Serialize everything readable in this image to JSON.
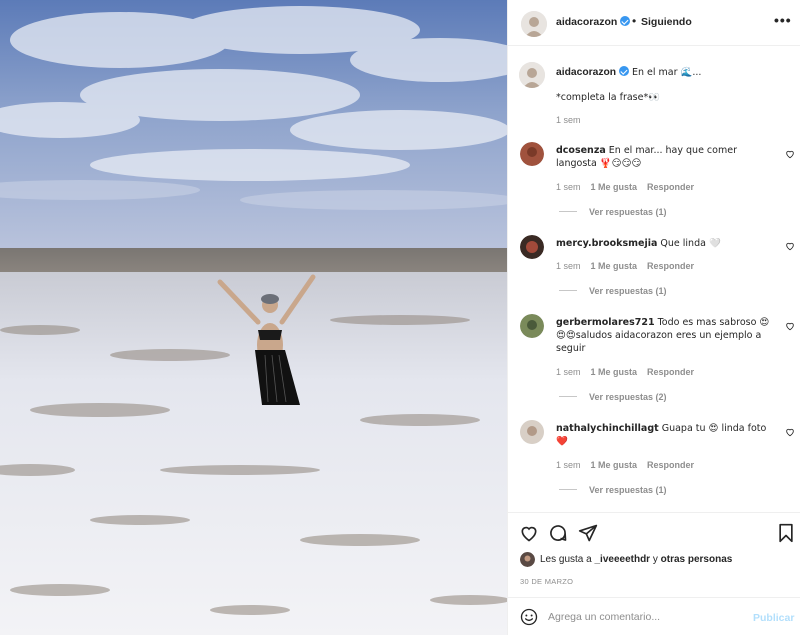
{
  "header": {
    "username": "aidacorazon",
    "separator": "•",
    "follow_label": "Siguiendo",
    "more_label": "•••"
  },
  "caption": {
    "username": "aidacorazon",
    "text_line1": "En el mar 🌊...",
    "text_line2": "*completa la frase*👀",
    "time": "1 sem"
  },
  "comments": [
    {
      "username": "dcosenza",
      "text": "En el mar... hay que comer langosta 🦞😏😏😏",
      "time": "1 sem",
      "likes": "1 Me gusta",
      "reply": "Responder",
      "view_replies": "Ver respuestas (1)"
    },
    {
      "username": "mercy.brooksmejia",
      "text": "Que linda 🤍",
      "time": "1 sem",
      "likes": "1 Me gusta",
      "reply": "Responder",
      "view_replies": "Ver respuestas (1)"
    },
    {
      "username": "gerbermolares721",
      "text": "Todo es mas sabroso 😍😍😍saludos aidacorazon eres un ejemplo a seguir",
      "time": "1 sem",
      "likes": "1 Me gusta",
      "reply": "Responder",
      "view_replies": "Ver respuestas (2)"
    },
    {
      "username": "nathalychinchillagt",
      "text": "Guapa tu 😍 linda foto ❤️",
      "time": "1 sem",
      "likes": "1 Me gusta",
      "reply": "Responder",
      "view_replies": "Ver respuestas (1)"
    }
  ],
  "actions": {
    "likes_prefix": "Les gusta a ",
    "likes_user": "_iveeeethdr",
    "likes_mid": " y ",
    "likes_others": "otras personas",
    "date": "30 DE MARZO"
  },
  "add_comment": {
    "placeholder": "Agrega un comentario...",
    "publish_label": "Publicar"
  },
  "colors": {
    "verified": "#3897f0",
    "publish_disabled": "#b2dffc",
    "muted": "#8e8e8e"
  },
  "icons": [
    "more-icon",
    "verified-icon",
    "heart-icon",
    "comment-icon",
    "share-icon",
    "bookmark-icon",
    "emoji-icon"
  ]
}
